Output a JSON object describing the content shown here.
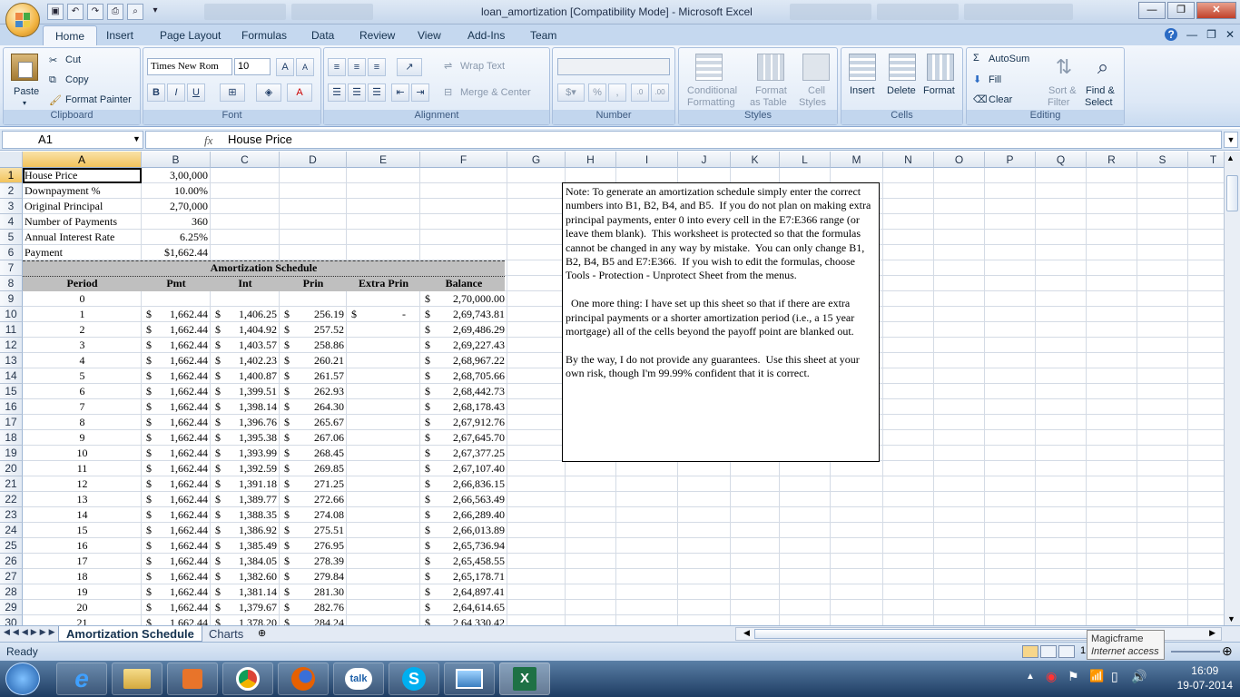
{
  "window": {
    "title": "loan_amortization  [Compatibility Mode] - Microsoft Excel",
    "min_label": "—",
    "max_label": "❐",
    "close_label": "✕"
  },
  "ribbon_tabs": [
    "Home",
    "Insert",
    "Page Layout",
    "Formulas",
    "Data",
    "Review",
    "View",
    "Add-Ins",
    "Team"
  ],
  "ribbon": {
    "clipboard": {
      "group": "Clipboard",
      "paste": "Paste",
      "cut": "Cut",
      "copy": "Copy",
      "format_painter": "Format Painter"
    },
    "font": {
      "group": "Font",
      "font_name": "Times New Rom",
      "font_size": "10",
      "bold": "B",
      "italic": "I",
      "underline": "U"
    },
    "alignment": {
      "group": "Alignment",
      "wrap_text": "Wrap Text",
      "merge_center": "Merge & Center"
    },
    "number": {
      "group": "Number",
      "percent": "%",
      "comma": ",",
      "inc_dec": ".00→.0",
      "dec_dec": ".0→.00"
    },
    "styles": {
      "group": "Styles",
      "conditional_1": "Conditional",
      "conditional_2": "Formatting",
      "format_table_1": "Format",
      "format_table_2": "as Table",
      "cell_styles_1": "Cell",
      "cell_styles_2": "Styles"
    },
    "cells": {
      "group": "Cells",
      "insert": "Insert",
      "delete": "Delete",
      "format": "Format"
    },
    "editing": {
      "group": "Editing",
      "autosum": "AutoSum",
      "fill": "Fill",
      "clear": "Clear",
      "sort_1": "Sort &",
      "sort_2": "Filter",
      "find_1": "Find &",
      "find_2": "Select"
    }
  },
  "formula_bar": {
    "name_box": "A1",
    "fx": "fx",
    "content": "House Price"
  },
  "columns": [
    "A",
    "B",
    "C",
    "D",
    "E",
    "F",
    "G",
    "H",
    "I",
    "J",
    "K",
    "L",
    "M",
    "N",
    "O",
    "P",
    "Q",
    "R",
    "S",
    "T"
  ],
  "rows": [
    "1",
    "2",
    "3",
    "4",
    "5",
    "6",
    "7",
    "8",
    "9",
    "10",
    "11",
    "12",
    "13",
    "14",
    "15",
    "16",
    "17",
    "18",
    "19",
    "20",
    "21",
    "22",
    "23",
    "24",
    "25",
    "26",
    "27",
    "28",
    "29",
    "30"
  ],
  "inputs": [
    {
      "label": "House Price",
      "value": "3,00,000"
    },
    {
      "label": "Downpayment %",
      "value": "10.00%"
    },
    {
      "label": "Original Principal",
      "value": "2,70,000"
    },
    {
      "label": "Number of Payments",
      "value": "360"
    },
    {
      "label": "Annual Interest Rate",
      "value": "6.25%"
    },
    {
      "label": "Payment",
      "value": "$1,662.44"
    }
  ],
  "schedule": {
    "title": "Amortization Schedule",
    "headers": [
      "Period",
      "Pmt",
      "Int",
      "Prin",
      "Extra Prin",
      "Balance"
    ],
    "currency": "$",
    "extra_dash": "-",
    "row0": {
      "period": "0",
      "balance": "2,70,000.00"
    },
    "rows": [
      [
        "1",
        "1,662.44",
        "1,406.25",
        "256.19",
        "2,69,743.81"
      ],
      [
        "2",
        "1,662.44",
        "1,404.92",
        "257.52",
        "2,69,486.29"
      ],
      [
        "3",
        "1,662.44",
        "1,403.57",
        "258.86",
        "2,69,227.43"
      ],
      [
        "4",
        "1,662.44",
        "1,402.23",
        "260.21",
        "2,68,967.22"
      ],
      [
        "5",
        "1,662.44",
        "1,400.87",
        "261.57",
        "2,68,705.66"
      ],
      [
        "6",
        "1,662.44",
        "1,399.51",
        "262.93",
        "2,68,442.73"
      ],
      [
        "7",
        "1,662.44",
        "1,398.14",
        "264.30",
        "2,68,178.43"
      ],
      [
        "8",
        "1,662.44",
        "1,396.76",
        "265.67",
        "2,67,912.76"
      ],
      [
        "9",
        "1,662.44",
        "1,395.38",
        "267.06",
        "2,67,645.70"
      ],
      [
        "10",
        "1,662.44",
        "1,393.99",
        "268.45",
        "2,67,377.25"
      ],
      [
        "11",
        "1,662.44",
        "1,392.59",
        "269.85",
        "2,67,107.40"
      ],
      [
        "12",
        "1,662.44",
        "1,391.18",
        "271.25",
        "2,66,836.15"
      ],
      [
        "13",
        "1,662.44",
        "1,389.77",
        "272.66",
        "2,66,563.49"
      ],
      [
        "14",
        "1,662.44",
        "1,388.35",
        "274.08",
        "2,66,289.40"
      ],
      [
        "15",
        "1,662.44",
        "1,386.92",
        "275.51",
        "2,66,013.89"
      ],
      [
        "16",
        "1,662.44",
        "1,385.49",
        "276.95",
        "2,65,736.94"
      ],
      [
        "17",
        "1,662.44",
        "1,384.05",
        "278.39",
        "2,65,458.55"
      ],
      [
        "18",
        "1,662.44",
        "1,382.60",
        "279.84",
        "2,65,178.71"
      ],
      [
        "19",
        "1,662.44",
        "1,381.14",
        "281.30",
        "2,64,897.41"
      ],
      [
        "20",
        "1,662.44",
        "1,379.67",
        "282.76",
        "2,64,614.65"
      ],
      [
        "21",
        "1,662.44",
        "1,378.20",
        "284.24",
        "2,64,330.42"
      ]
    ]
  },
  "note": "Note: To generate an amortization schedule simply enter the correct numbers into B1, B2, B4, and B5.  If you do not plan on making extra principal payments, enter 0 into every cell in the E7:E366 range (or leave them blank).  This worksheet is protected so that the formulas cannot be changed in any way by mistake.  You can only change B1, B2, B4, B5 and E7:E366.  If you wish to edit the formulas, choose Tools - Protection - Unprotect Sheet from the menus.\n\n  One more thing: I have set up this sheet so that if there are extra principal payments or a shorter amortization period (i.e., a 15 year mortgage) all of the cells beyond the payoff point are blanked out.\n\nBy the way, I do not provide any guarantees.  Use this sheet at your own risk, though I'm 99.99% confident that it is correct.",
  "sheet_tabs": [
    "Amortization Schedule",
    "Charts"
  ],
  "status": {
    "ready": "Ready",
    "zoom_hint": "1"
  },
  "tooltip": {
    "line1": "Magicframe",
    "line2": "Internet access"
  },
  "tray": {
    "time": "16:09",
    "date": "19-07-2014"
  },
  "colors": {
    "accent": "#2b579a",
    "band": "#bfbfbf",
    "selected_header": "#f2c35c",
    "excel_green": "#1e7145"
  }
}
